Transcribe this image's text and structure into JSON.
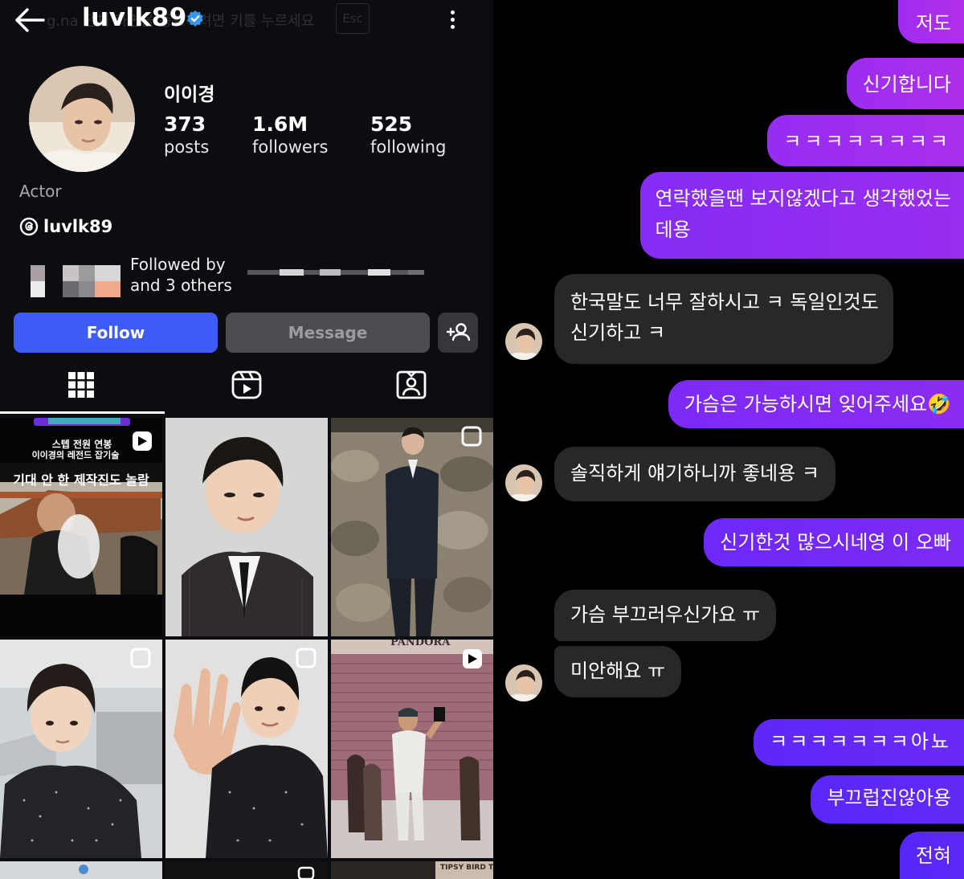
{
  "profile": {
    "username": "luvlk89",
    "overlay_hint": "g.na 전체 화면을 종료하려면 키를 누르세요",
    "esc_key": "Esc",
    "display_name": "이이경",
    "stats": [
      {
        "value": "373",
        "label": "posts"
      },
      {
        "value": "1.6M",
        "label": "followers"
      },
      {
        "value": "525",
        "label": "following"
      }
    ],
    "category": "Actor",
    "threads_handle": "luvlk89",
    "followed_by_line1": "Followed by",
    "followed_by_line2": "and 3 others",
    "buttons": {
      "follow": "Follow",
      "message": "Message"
    },
    "tabs": [
      "grid-icon",
      "reels-icon",
      "tagged-icon"
    ],
    "accent_color": "#3d5cf5",
    "posts": [
      {
        "banner": "스텝 전원 연봉",
        "banner2": "이이경의 레전드 잡기술",
        "caption": "기대 안 한 제작진도 놀람"
      },
      {},
      {},
      {},
      {},
      {
        "sign": "PANDORA"
      },
      {},
      {},
      {
        "sign": "TIPSY BIRD TACOS"
      }
    ]
  },
  "chat": {
    "sent_gradient": [
      "#7b2cff",
      "#a12cf0"
    ],
    "received_color": "#28282b",
    "messages": [
      {
        "dir": "sent",
        "text": "저도"
      },
      {
        "dir": "sent",
        "text": "신기합니다"
      },
      {
        "dir": "sent",
        "text": "ㅋㅋㅋㅋㅋㅋㅋㅋ"
      },
      {
        "dir": "sent",
        "text": "연락했을땐 보지않겠다고 생각했었는",
        "text2": "데용"
      },
      {
        "dir": "received",
        "text": "한국말도 너무 잘하시고 ㅋ 독일인것도",
        "text2": "신기하고 ㅋ"
      },
      {
        "dir": "sent",
        "text": "가슴은 가능하시면 잊어주세요🤣"
      },
      {
        "dir": "received",
        "text": "솔직하게 얘기하니까 좋네용 ㅋ"
      },
      {
        "dir": "sent",
        "text": "신기한것 많으시네영 이 오빠"
      },
      {
        "dir": "received",
        "text": "가슴 부끄러우신가요 ㅠ"
      },
      {
        "dir": "received",
        "text": "미안해요 ㅠ"
      },
      {
        "dir": "sent",
        "text": "ㅋㅋㅋㅋㅋㅋㅋ아뇨"
      },
      {
        "dir": "sent",
        "text": "부끄럽진않아용"
      },
      {
        "dir": "sent",
        "text": "전혀"
      }
    ]
  }
}
